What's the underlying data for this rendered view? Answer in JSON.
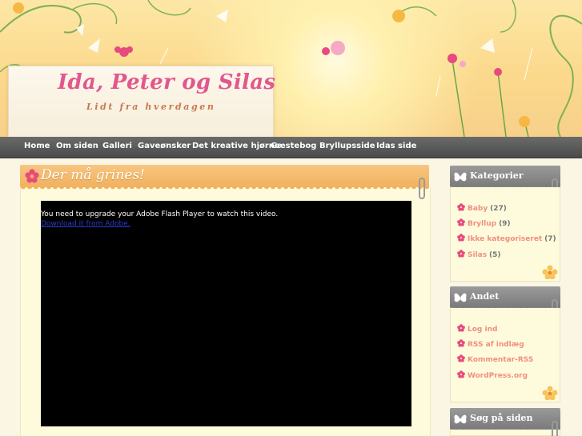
{
  "site": {
    "title": "Ida, Peter og Silas",
    "tagline": "Lidt fra hverdagen"
  },
  "nav": {
    "items": [
      {
        "label": "Home"
      },
      {
        "label": "Om siden"
      },
      {
        "label": "Galleri"
      },
      {
        "label": "Gaveønsker"
      },
      {
        "label": "Det kreative hjørne"
      },
      {
        "label": "Gæstebog"
      },
      {
        "label": "Bryllupsside"
      },
      {
        "label": "Idas side"
      }
    ]
  },
  "post": {
    "title": "Der må grines!",
    "video": {
      "message": "You need to upgrade your Adobe Flash Player to watch this video.",
      "link": "Download it from Adobe."
    }
  },
  "sidebar": {
    "categories": {
      "title": "Kategorier",
      "items": [
        {
          "label": "Baby",
          "count": "(27)"
        },
        {
          "label": "Bryllup",
          "count": "(9)"
        },
        {
          "label": "Ikke kategoriseret",
          "count": "(7)"
        },
        {
          "label": "Silas",
          "count": "(5)"
        }
      ]
    },
    "other": {
      "title": "Andet",
      "items": [
        {
          "label": "Log ind"
        },
        {
          "label": "RSS af indlæg"
        },
        {
          "label": "Kommentar-RSS"
        },
        {
          "label": "WordPress.org"
        }
      ]
    },
    "search": {
      "title": "Søg på siden"
    }
  },
  "colors": {
    "accent_pink": "#e2578d",
    "nav_bg": "#555555",
    "post_header": "#f1b15f",
    "widget_header": "#8a8a8a",
    "link": "#f09080"
  }
}
